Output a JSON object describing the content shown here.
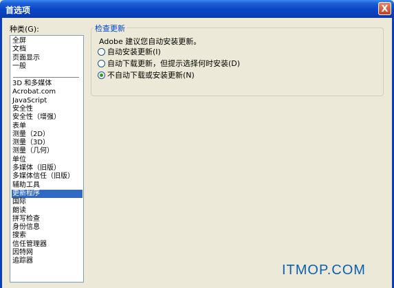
{
  "window": {
    "title": "首选项",
    "close_glyph": "X"
  },
  "categories": {
    "label": "种类(G):",
    "group1": [
      "全屏",
      "文档",
      "页面显示",
      "一般"
    ],
    "group2": [
      "3D 和多媒体",
      "Acrobat.com",
      "JavaScript",
      "安全性",
      "安全性（增强）",
      "表单",
      "测量（2D）",
      "测量（3D）",
      "测量（几何）",
      "单位",
      "多媒体（旧版）",
      "多媒体信任（旧版）",
      "辅助工具",
      "更新程序",
      "国际",
      "朗读",
      "拼写检查",
      "身份信息",
      "搜索",
      "信任管理器",
      "因特网",
      "追踪器"
    ],
    "selected": "更新程序"
  },
  "update": {
    "group_title": "检查更新",
    "description": "Adobe 建议您自动安装更新。",
    "options": [
      {
        "label": "自动安装更新(I)",
        "checked": false
      },
      {
        "label": "自动下载更新，但提示选择何时安装(D)",
        "checked": false
      },
      {
        "label": "不自动下载或安装更新(N)",
        "checked": true
      }
    ]
  },
  "watermark": "ITMOP.COM"
}
